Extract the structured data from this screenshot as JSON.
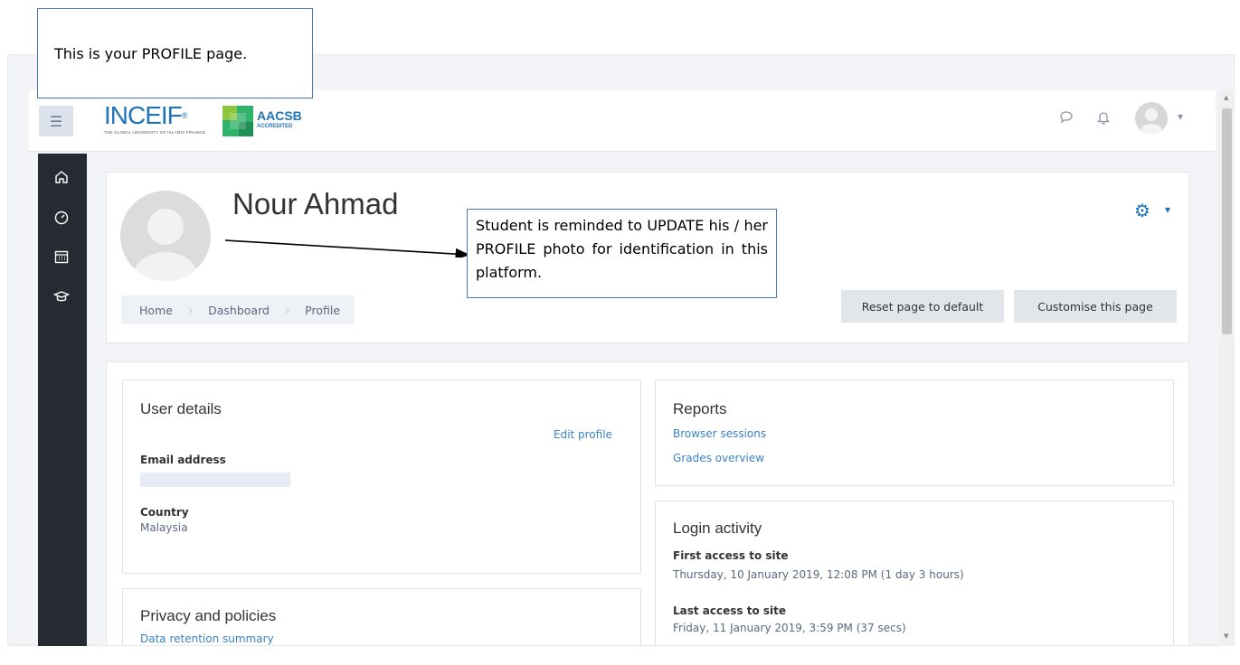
{
  "annotations": {
    "profile_note": "This is your PROFILE page.",
    "photo_note": "Student is reminded to UPDATE his / her PROFILE photo for identification in this platform."
  },
  "navbar": {
    "logo_primary": "INCEIF",
    "logo_primary_mark": "®",
    "logo_primary_tagline": "THE GLOBAL UNIVERSITY OF ISLAMIC FINANCE",
    "logo_secondary": "AACSB",
    "logo_secondary_sub": "ACCREDITED",
    "icons": [
      "menu-icon",
      "message-icon",
      "bell-icon",
      "user-avatar",
      "caret-down-icon"
    ]
  },
  "sidebar": {
    "items": [
      {
        "icon": "home-icon"
      },
      {
        "icon": "dashboard-icon"
      },
      {
        "icon": "calendar-icon"
      },
      {
        "icon": "courses-icon"
      }
    ]
  },
  "header": {
    "name": "Nour Ahmad",
    "breadcrumb": [
      "Home",
      "Dashboard",
      "Profile"
    ],
    "reset_button": "Reset page to default",
    "customise_button": "Customise this page"
  },
  "user_details": {
    "title": "User details",
    "edit_link": "Edit profile",
    "email_label": "Email address",
    "country_label": "Country",
    "country_value": "Malaysia"
  },
  "privacy": {
    "title": "Privacy and policies",
    "link": "Data retention summary"
  },
  "reports": {
    "title": "Reports",
    "links": [
      "Browser sessions",
      "Grades overview"
    ]
  },
  "login_activity": {
    "title": "Login activity",
    "first_label": "First access to site",
    "first_value": "Thursday, 10 January 2019, 12:08 PM  (1 day 3 hours)",
    "last_label": "Last access to site",
    "last_value": "Friday, 11 January 2019, 3:59 PM  (37 secs)"
  },
  "colors": {
    "brand": "#1e73b9",
    "link": "#3c82c4",
    "sidebar": "#262b33",
    "annotation_border": "#4a78b5"
  }
}
